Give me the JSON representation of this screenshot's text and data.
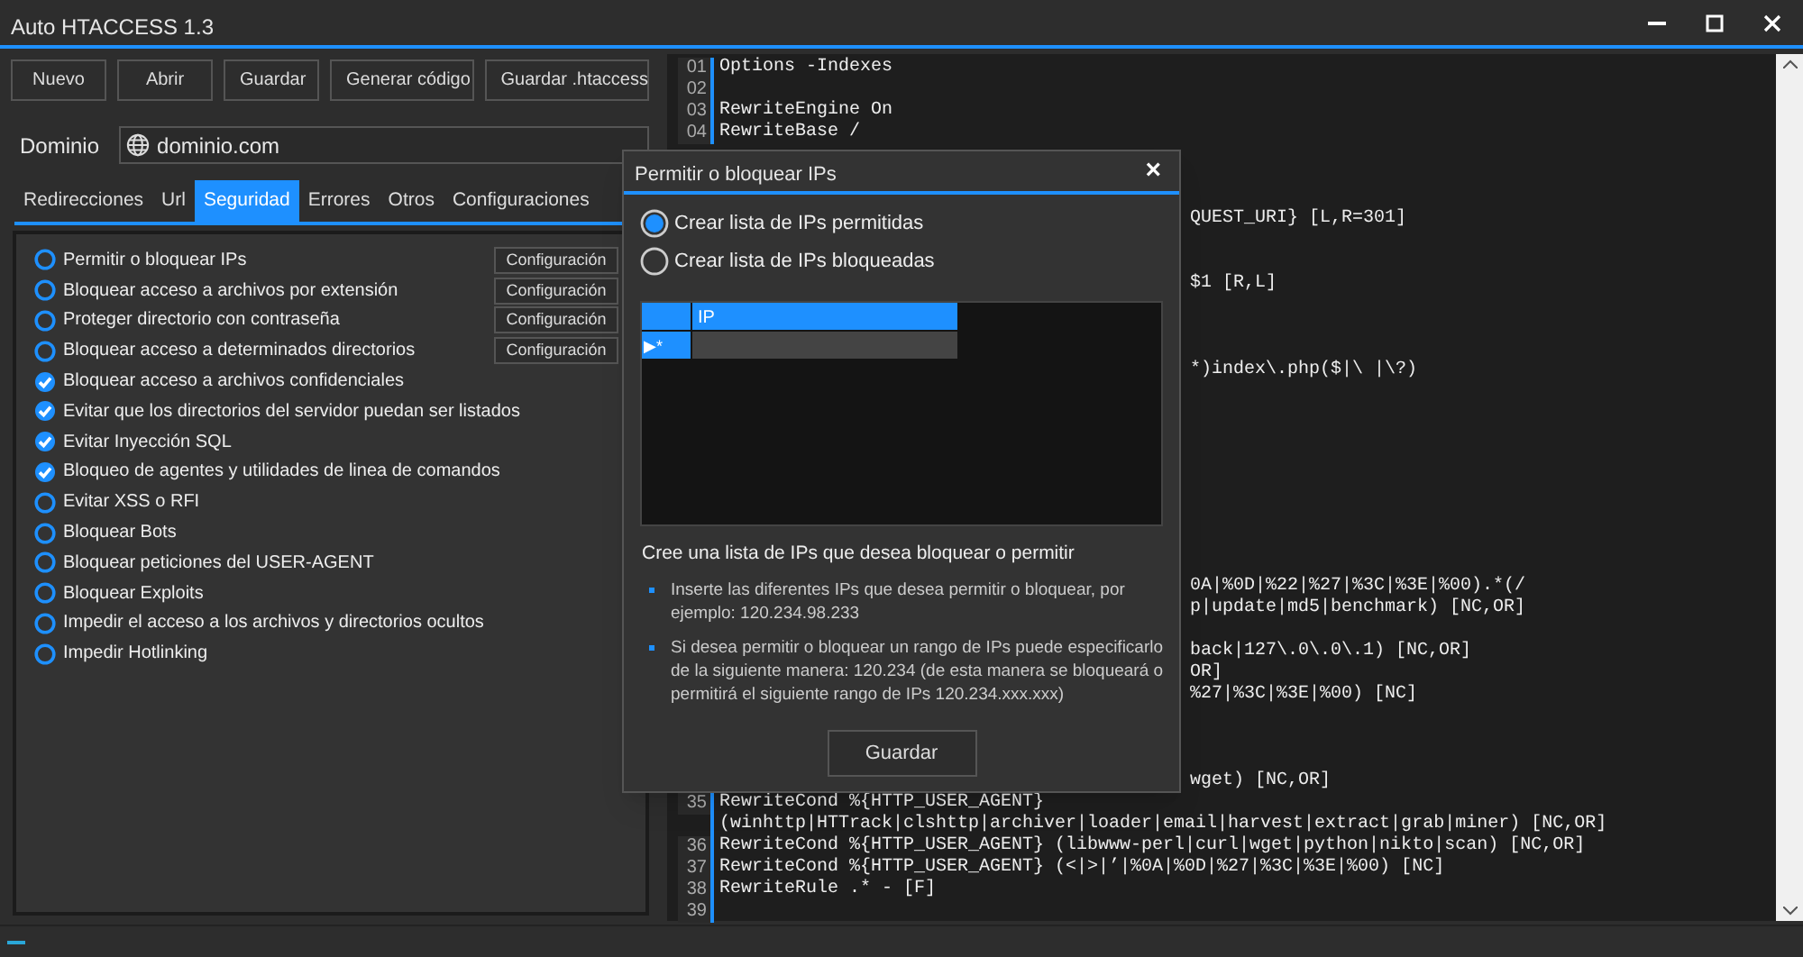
{
  "window": {
    "title": "Auto HTACCESS 1.3"
  },
  "toolbar": [
    "Nuevo",
    "Abrir",
    "Guardar",
    "Generar código",
    "Guardar .htaccess"
  ],
  "domain": {
    "label": "Dominio",
    "value": "dominio.com"
  },
  "tabs": [
    {
      "label": "Redirecciones",
      "selected": false
    },
    {
      "label": "Url",
      "selected": false
    },
    {
      "label": "Seguridad",
      "selected": true
    },
    {
      "label": "Errores",
      "selected": false
    },
    {
      "label": "Otros",
      "selected": false
    },
    {
      "label": "Configuraciones",
      "selected": false
    }
  ],
  "options": [
    {
      "label": "Permitir o bloquear IPs",
      "checked": false,
      "button": "Configuración"
    },
    {
      "label": "Bloquear acceso a archivos por extensión",
      "checked": false,
      "button": "Configuración"
    },
    {
      "label": "Proteger directorio con contraseña",
      "checked": false,
      "button": "Configuración"
    },
    {
      "label": "Bloquear acceso a determinados directorios",
      "checked": false,
      "button": "Configuración"
    },
    {
      "label": "Bloquear acceso a archivos confidenciales",
      "checked": true
    },
    {
      "label": "Evitar que los directorios del servidor puedan ser listados",
      "checked": true
    },
    {
      "label": "Evitar Inyección SQL",
      "checked": true
    },
    {
      "label": "Bloqueo de agentes y utilidades de linea de comandos",
      "checked": true
    },
    {
      "label": "Evitar XSS o RFI",
      "checked": false
    },
    {
      "label": "Bloquear Bots",
      "checked": false
    },
    {
      "label": "Bloquear peticiones del USER-AGENT",
      "checked": false
    },
    {
      "label": "Bloquear Exploits",
      "checked": false
    },
    {
      "label": "Impedir el acceso a los archivos y directorios ocultos",
      "checked": false
    },
    {
      "label": "Impedir Hotlinking",
      "checked": false
    }
  ],
  "code_lines": [
    {
      "kind": "full",
      "number": "01",
      "text": "Options -Indexes"
    },
    {
      "kind": "full",
      "number": "02"
    },
    {
      "kind": "full",
      "number": "03",
      "text": "RewriteEngine On"
    },
    {
      "kind": "full",
      "number": "04",
      "text": "RewriteBase /"
    },
    {
      "kind": "partial",
      "text": "QUEST_URI} [L,R=301]"
    },
    {
      "kind": "partial",
      "text": "$1 [R,L]"
    },
    {
      "kind": "partial",
      "text": "*)index\\.php($|\\ |\\?)"
    },
    {
      "kind": "partial",
      "text": "0A|%0D|%22|%27|%3C|%3E|%00).*(/"
    },
    {
      "kind": "partial",
      "text": "p|update|md5|benchmark) [NC,OR]"
    },
    {
      "kind": "partial",
      "text": "back|127\\.0\\.0\\.1) [NC,OR]"
    },
    {
      "kind": "partial",
      "text": "OR]"
    },
    {
      "kind": "partial",
      "text": "%27|%3C|%3E|%00) [NC]"
    },
    {
      "kind": "partial",
      "text": "wget) [NC,OR]"
    },
    {
      "kind": "full",
      "number": "35",
      "text": "RewriteCond %{HTTP_USER_AGENT}"
    },
    {
      "kind": "wrap",
      "text": "(winhttp|HTTrack|clshttp|archiver|loader|email|harvest|extract|grab|miner) [NC,OR]"
    },
    {
      "kind": "full",
      "number": "36",
      "text": "RewriteCond %{HTTP_USER_AGENT} (libwww-perl|curl|wget|python|nikto|scan) [NC,OR]"
    },
    {
      "kind": "full",
      "number": "37",
      "text": "RewriteCond %{HTTP_USER_AGENT} (<|>|’|%0A|%0D|%27|%3C|%3E|%00) [NC]"
    },
    {
      "kind": "full",
      "number": "38",
      "text": "RewriteRule .* - [F]"
    },
    {
      "kind": "full",
      "number": "39"
    }
  ],
  "dialog": {
    "title": "Permitir o bloquear IPs",
    "close": "×",
    "radios": [
      {
        "label": "Crear lista de IPs permitidas",
        "selected": true
      },
      {
        "label": "Crear lista de IPs bloqueadas",
        "selected": false
      }
    ],
    "grid": {
      "columns": [
        "IP"
      ],
      "row_marker": "▶*"
    },
    "intro": "Cree una lista de IPs que desea bloquear o permitir",
    "bullets": [
      "Inserte las diferentes IPs que desea permitir o bloquear, por ejemplo: 120.234.98.233",
      "Si desea permitir o bloquear un rango de IPs puede especificarlo de la siguiente manera: 120.234 (de esta manera se bloqueará o permitirá el siguiente rango de IPs 120.234.xxx.xxx)"
    ],
    "button": "Guardar"
  }
}
